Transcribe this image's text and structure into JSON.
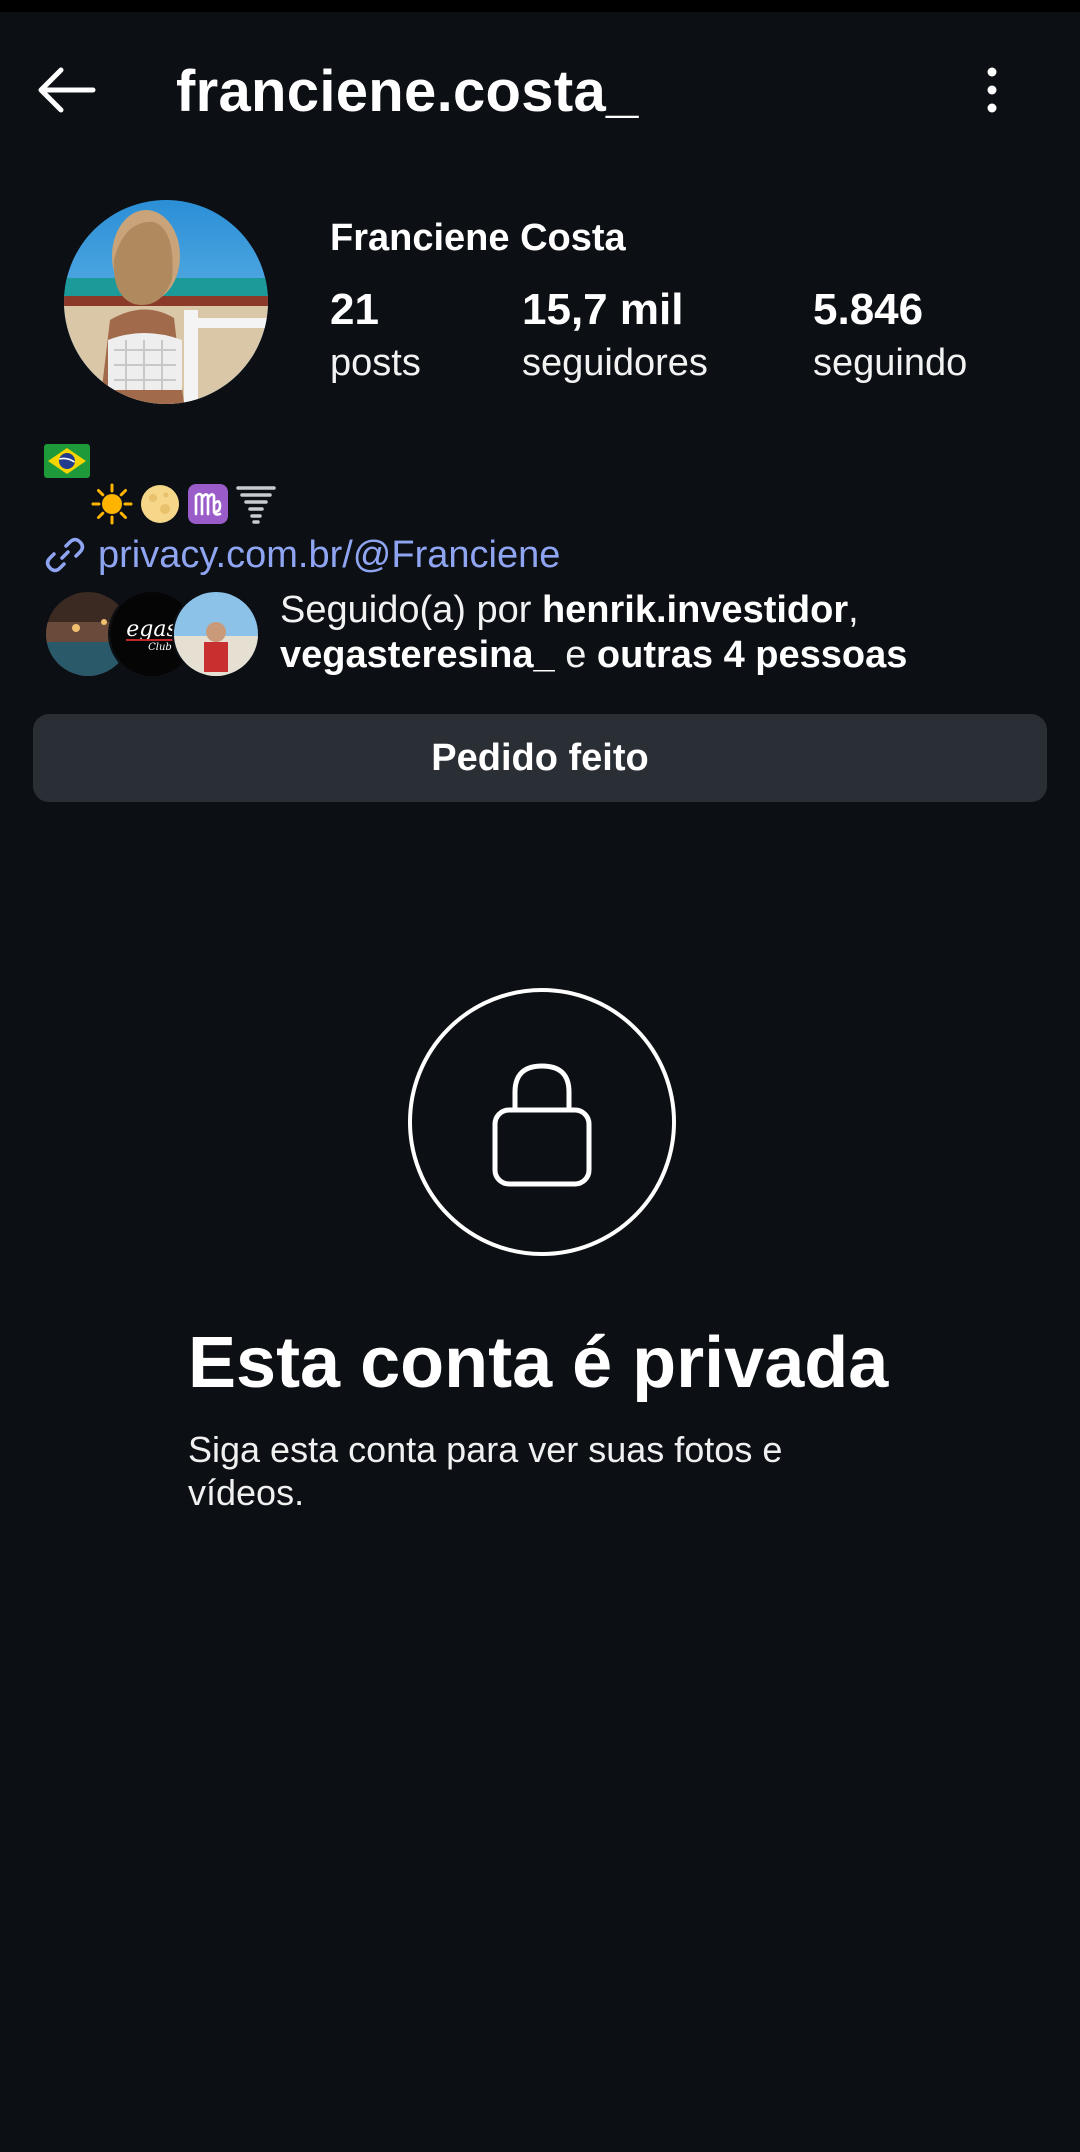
{
  "header": {
    "username": "franciene.costa_",
    "back_icon": "arrow-left-icon",
    "more_icon": "vertical-dots-icon"
  },
  "profile": {
    "name": "Franciene Costa",
    "stats": [
      {
        "value": "21",
        "label": "posts"
      },
      {
        "value": "15,7 mil",
        "label": "seguidores"
      },
      {
        "value": "5.846",
        "label": "seguindo"
      }
    ]
  },
  "bio": {
    "flag_icon": "brazil-flag-icon",
    "emojis": [
      "sun-icon",
      "full-moon-icon",
      "virgo-icon",
      "tornado-icon"
    ],
    "link_icon": "link-icon",
    "link_text": "privacy.com.br/@Franciene"
  },
  "followed_by": {
    "prefix": "Seguido(a) por ",
    "user1": "henrik.investidor",
    "comma": ",",
    "user2": "vegasteresina_",
    "connector": " e ",
    "others": "outras 4 pessoas",
    "avatar_text": [
      "egas",
      "Club"
    ]
  },
  "actions": {
    "request_label": "Pedido feito"
  },
  "private": {
    "lock_icon": "lock-icon",
    "title": "Esta conta é privada",
    "subtitle": "Siga esta conta para ver suas fotos e vídeos."
  },
  "colors": {
    "background": "#0c0f14",
    "button": "#2a2e35",
    "link": "#8fa5f2"
  }
}
